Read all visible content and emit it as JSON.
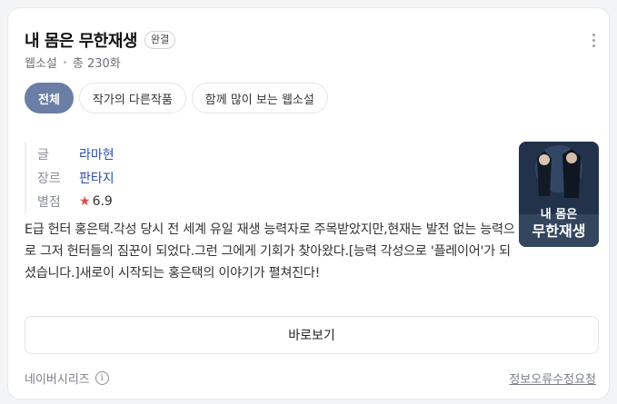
{
  "header": {
    "title": "내 몸은 무한재생",
    "badge": "완결",
    "category": "웹소설",
    "episodes": "총 230화"
  },
  "tabs": [
    {
      "label": "전체",
      "active": true
    },
    {
      "label": "작가의 다른작품",
      "active": false
    },
    {
      "label": "함께 많이 보는 웹소설",
      "active": false
    }
  ],
  "info": {
    "author_key": "글",
    "author": "라마현",
    "genre_key": "장르",
    "genre": "판타지",
    "rating_key": "별점",
    "rating": "6.9"
  },
  "cover": {
    "title_top": "내 몸은",
    "title_bottom": "무한재생"
  },
  "description": "E급 헌터 홍은택.각성 당시 전 세계 유일 재생 능력자로 주목받았지만,현재는 발전 없는 능력으로 그저 헌터들의 짐꾼이 되었다.그런 그에게 기회가 찾아왔다.[능력 각성으로 '플레이어'가 되셨습니다.]새로이 시작되는 홍은택의 이야기가 펼쳐진다!",
  "watch_button": "바로보기",
  "footer": {
    "source": "네이버시리즈",
    "report": "정보오류수정요청"
  },
  "colors": {
    "active_tab": "#6b7ea6",
    "link": "#2b4fa8",
    "star": "#e5484d"
  }
}
